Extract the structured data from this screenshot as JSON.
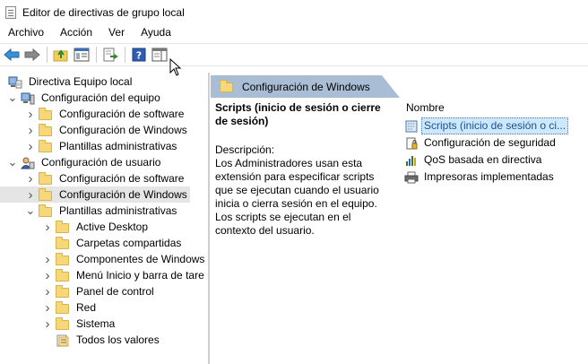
{
  "window": {
    "title": "Editor de directivas de grupo local",
    "icon": "gpedit-icon"
  },
  "menu": [
    "Archivo",
    "Acción",
    "Ver",
    "Ayuda"
  ],
  "toolbar": {
    "buttons": [
      "back-arrow-icon",
      "forward-arrow-icon",
      "up-folder-icon",
      "show-hide-tree-icon",
      "export-list-icon",
      "help-icon",
      "action-pane-icon"
    ]
  },
  "tree": {
    "root": "Directiva Equipo local",
    "items": [
      {
        "label": "Directiva Equipo local",
        "level": 0,
        "expand": "",
        "icon": "computer-policy-icon"
      },
      {
        "label": "Configuración del equipo",
        "level": 1,
        "expand": "expanded",
        "icon": "computer-icon"
      },
      {
        "label": "Configuración de software",
        "level": 2,
        "expand": "collapsed",
        "icon": "folder-icon"
      },
      {
        "label": "Configuración de Windows",
        "level": 2,
        "expand": "collapsed",
        "icon": "folder-icon"
      },
      {
        "label": "Plantillas administrativas",
        "level": 2,
        "expand": "collapsed",
        "icon": "folder-icon"
      },
      {
        "label": "Configuración de usuario",
        "level": 1,
        "expand": "expanded",
        "icon": "user-icon"
      },
      {
        "label": "Configuración de software",
        "level": 2,
        "expand": "collapsed",
        "icon": "folder-icon"
      },
      {
        "label": "Configuración de Windows",
        "level": 2,
        "expand": "collapsed",
        "icon": "folder-icon",
        "selected": true
      },
      {
        "label": "Plantillas administrativas",
        "level": 2,
        "expand": "expanded",
        "icon": "folder-icon"
      },
      {
        "label": "Active Desktop",
        "level": 3,
        "expand": "collapsed",
        "icon": "folder-icon"
      },
      {
        "label": "Carpetas compartidas",
        "level": 3,
        "expand": "",
        "icon": "folder-icon"
      },
      {
        "label": "Componentes de Windows",
        "level": 3,
        "expand": "collapsed",
        "icon": "folder-icon"
      },
      {
        "label": "Menú Inicio y barra de tare",
        "level": 3,
        "expand": "collapsed",
        "icon": "folder-icon"
      },
      {
        "label": "Panel de control",
        "level": 3,
        "expand": "collapsed",
        "icon": "folder-icon"
      },
      {
        "label": "Red",
        "level": 3,
        "expand": "collapsed",
        "icon": "folder-icon"
      },
      {
        "label": "Sistema",
        "level": 3,
        "expand": "collapsed",
        "icon": "folder-icon"
      },
      {
        "label": "Todos los valores",
        "level": 3,
        "expand": "",
        "icon": "all-settings-icon"
      }
    ]
  },
  "details": {
    "header_title": "Configuración de Windows",
    "item_title": "Scripts (inicio de sesión o cierre de sesión)",
    "description_label": "Descripción:",
    "description_text": "Los Administradores usan esta extensión para especificar scripts que se ejecutan cuando el usuario inicia o cierra sesión en el equipo. Los scripts se ejecutan en el contexto del usuario.",
    "column_header": "Nombre",
    "items": [
      {
        "label": "Scripts (inicio de sesión o ci...",
        "icon": "scripts-icon",
        "selected": true
      },
      {
        "label": "Configuración de seguridad",
        "icon": "security-settings-icon"
      },
      {
        "label": "QoS basada en directiva",
        "icon": "qos-chart-icon"
      },
      {
        "label": "Impresoras implementadas",
        "icon": "printer-icon"
      }
    ]
  },
  "colors": {
    "header_bg": "#a9bed5",
    "selected_tree_bg": "#e5e5e5",
    "selected_list_bg": "#cce8ff"
  }
}
